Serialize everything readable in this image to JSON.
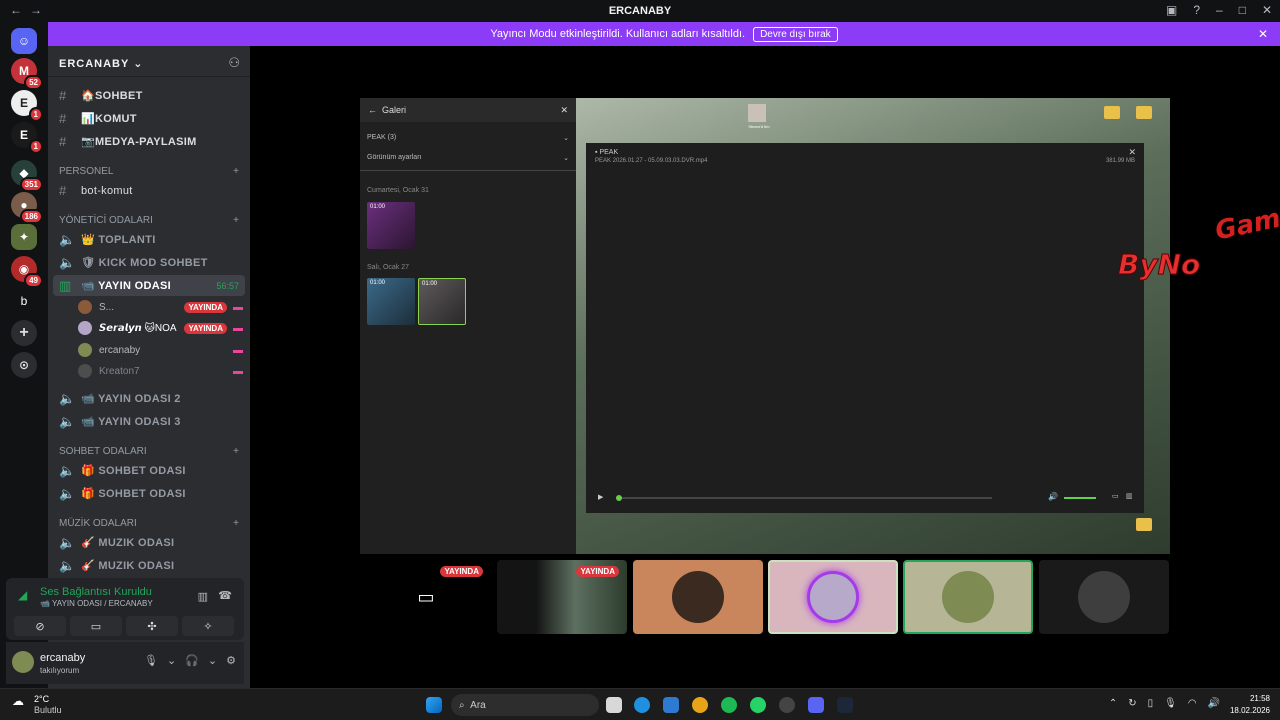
{
  "window": {
    "title": "ERCANABY",
    "nav_back": "←",
    "nav_fwd": "→"
  },
  "banner": {
    "text": "Yayıncı Modu etkinleştirildi. Kullanıcı adları kısaltıldı.",
    "button": "Devre dışı bırak"
  },
  "rail": {
    "badges": [
      "52",
      "1",
      "1",
      "351",
      "186",
      "49"
    ],
    "letter": "b"
  },
  "guild": {
    "name": "ERCANABY"
  },
  "channels": {
    "top": [
      "🏠SOHBET",
      "📊KOMUT",
      "📷MEDYA-PAYLASIM"
    ],
    "personel": {
      "label": "PERSONEL",
      "items": [
        "bot-komut"
      ]
    },
    "yonetici": {
      "label": "YÖNETİCİ ODALARI",
      "items": [
        "👑 TOPLANTI",
        "🛡 KICK MOD SOHBET"
      ]
    },
    "active": {
      "label": "📹 YAYIN ODASI",
      "time": "56:57"
    },
    "voice_users": [
      {
        "name": "S...",
        "live": "YAYINDA"
      },
      {
        "name": "𝙎𝙚𝙧𝙖𝙡𝙮𝙣 🐱NOA",
        "live": "YAYINDA"
      },
      {
        "name": "ercanaby",
        "live": ""
      },
      {
        "name": "Kreaton7",
        "live": ""
      }
    ],
    "more_voice": [
      "📹 YAYIN ODASI 2",
      "📹 YAYIN ODASI 3"
    ],
    "sohbet": {
      "label": "SOHBET ODALARI",
      "items": [
        "🎁 SOHBET ODASI",
        "🎁 SOHBET ODASI"
      ]
    },
    "muzik": {
      "label": "MÜZİK ODALARI",
      "items": [
        "🎸 MUZIK ODASI",
        "🎸 MUZIK ODASI"
      ]
    }
  },
  "voice": {
    "status": "Ses Bağlantısı Kuruldu",
    "channel": "📹 YAYIN ODASI / ERCANABY"
  },
  "user": {
    "name": "ercanaby",
    "status": "takılıyorum"
  },
  "stream": {
    "gallery_title": "Galeri",
    "peak_row": "PEAK (3)",
    "view_row": "Görünüm ayarları",
    "date1": "Cumartesi, Ocak 31",
    "date2": "Salı, Ocak 27",
    "thumb_time": "01:00",
    "player_title": "PEAK",
    "file_name": "PEAK 2026.01.27 - 05.09.03.03.DVR.mp4",
    "file_size": "381.99 MB",
    "desk_icon_label": "Steam'd Itm"
  },
  "logo_text": {
    "part1": "ByNo",
    "part2": "Gam"
  },
  "tiles": {
    "live": "YAYINDA"
  },
  "taskbar": {
    "temp": "2°C",
    "weather": "Bulutlu",
    "search": "Ara",
    "time": "21:58",
    "date": "18.02.2026"
  },
  "colors": {
    "accent": "#8c3bf7",
    "live": "#da373c",
    "online": "#23a55a"
  }
}
